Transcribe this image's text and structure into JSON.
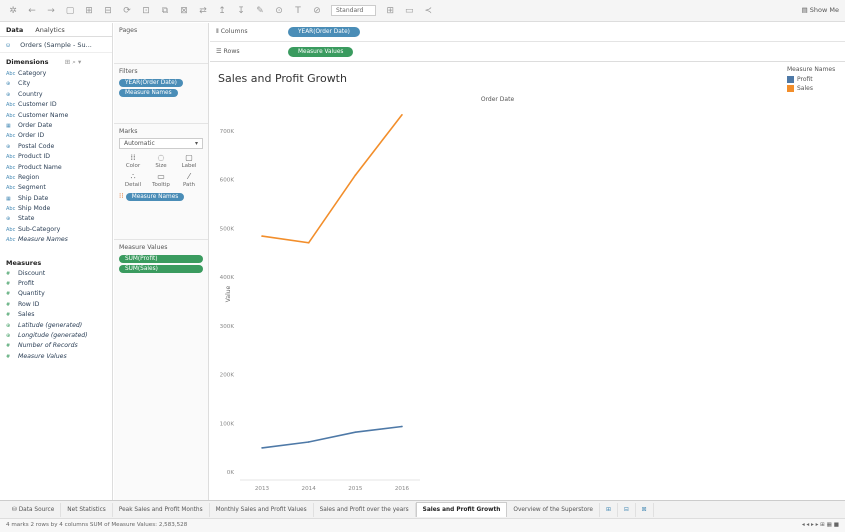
{
  "toolbar": {
    "fit_select": "Standard",
    "show_me": "Show Me"
  },
  "datapane": {
    "tabs": [
      "Data",
      "Analytics"
    ],
    "datasource": "Orders (Sample - Su...",
    "dimensions_header": "Dimensions",
    "dimensions": [
      {
        "type": "Abc",
        "name": "Category"
      },
      {
        "type": "⊕",
        "name": "City"
      },
      {
        "type": "⊕",
        "name": "Country"
      },
      {
        "type": "Abc",
        "name": "Customer ID"
      },
      {
        "type": "Abc",
        "name": "Customer Name"
      },
      {
        "type": "▦",
        "name": "Order Date"
      },
      {
        "type": "Abc",
        "name": "Order ID"
      },
      {
        "type": "⊕",
        "name": "Postal Code"
      },
      {
        "type": "Abc",
        "name": "Product ID"
      },
      {
        "type": "Abc",
        "name": "Product Name"
      },
      {
        "type": "Abc",
        "name": "Region"
      },
      {
        "type": "Abc",
        "name": "Segment"
      },
      {
        "type": "▦",
        "name": "Ship Date"
      },
      {
        "type": "Abc",
        "name": "Ship Mode"
      },
      {
        "type": "⊕",
        "name": "State"
      },
      {
        "type": "Abc",
        "name": "Sub-Category"
      },
      {
        "type": "Abc",
        "name": "Measure Names",
        "italic": true
      }
    ],
    "measures_header": "Measures",
    "measures": [
      {
        "type": "#",
        "name": "Discount"
      },
      {
        "type": "#",
        "name": "Profit"
      },
      {
        "type": "#",
        "name": "Quantity"
      },
      {
        "type": "#",
        "name": "Row ID"
      },
      {
        "type": "#",
        "name": "Sales"
      },
      {
        "type": "⊕",
        "name": "Latitude (generated)",
        "italic": true
      },
      {
        "type": "⊕",
        "name": "Longitude (generated)",
        "italic": true
      },
      {
        "type": "#",
        "name": "Number of Records",
        "italic": true
      },
      {
        "type": "#",
        "name": "Measure Values",
        "italic": true
      }
    ]
  },
  "shelves": {
    "pages_label": "Pages",
    "filters_label": "Filters",
    "filters": [
      "YEAR(Order Date)",
      "Measure Names"
    ],
    "marks_label": "Marks",
    "marks_type": "Automatic",
    "marks_buttons": [
      {
        "icon": "⁞⁞",
        "label": "Color"
      },
      {
        "icon": "◌",
        "label": "Size"
      },
      {
        "icon": "▢",
        "label": "Label"
      },
      {
        "icon": "∴",
        "label": "Detail"
      },
      {
        "icon": "▭",
        "label": "Tooltip"
      },
      {
        "icon": "⁄",
        "label": "Path"
      }
    ],
    "marks_pill": "Measure Names",
    "measure_values_label": "Measure Values",
    "measure_values": [
      "SUM(Profit)",
      "SUM(Sales)"
    ]
  },
  "columns_shelf": {
    "label": "Columns",
    "pill": "YEAR(Order Date)"
  },
  "rows_shelf": {
    "label": "Rows",
    "pill": "Measure Values"
  },
  "sheet": {
    "title": "Sales and Profit Growth",
    "column_header": "Order Date"
  },
  "legend": {
    "title": "Measure Names",
    "items": [
      {
        "name": "Profit",
        "color": "#4e79a7"
      },
      {
        "name": "Sales",
        "color": "#f28e2b"
      }
    ]
  },
  "chart_data": {
    "type": "line",
    "title": "Sales and Profit Growth",
    "xlabel": "Order Date",
    "ylabel": "Value",
    "categories": [
      "2013",
      "2014",
      "2015",
      "2016"
    ],
    "y_ticks": [
      "0K",
      "100K",
      "200K",
      "300K",
      "400K",
      "500K",
      "600K",
      "700K"
    ],
    "ylim": [
      0,
      780000
    ],
    "series": [
      {
        "name": "Profit",
        "color": "#4e79a7",
        "values": [
          49544,
          61619,
          81795,
          93440
        ]
      },
      {
        "name": "Sales",
        "color": "#f28e2b",
        "values": [
          484247,
          470533,
          609206,
          733215
        ]
      }
    ],
    "grid": false,
    "legend": "right"
  },
  "tabs": [
    "Data Source",
    "Net Statistics",
    "Peak Sales and Profit Months",
    "Monthly Sales and Profit Values",
    "Sales and Profit over the years",
    "Sales and Profit Growth",
    "Overview of the Superstore"
  ],
  "active_tab": "Sales and Profit Growth",
  "status": {
    "text": "4 marks   2 rows by 4 columns   SUM of Measure Values: 2,583,528"
  }
}
